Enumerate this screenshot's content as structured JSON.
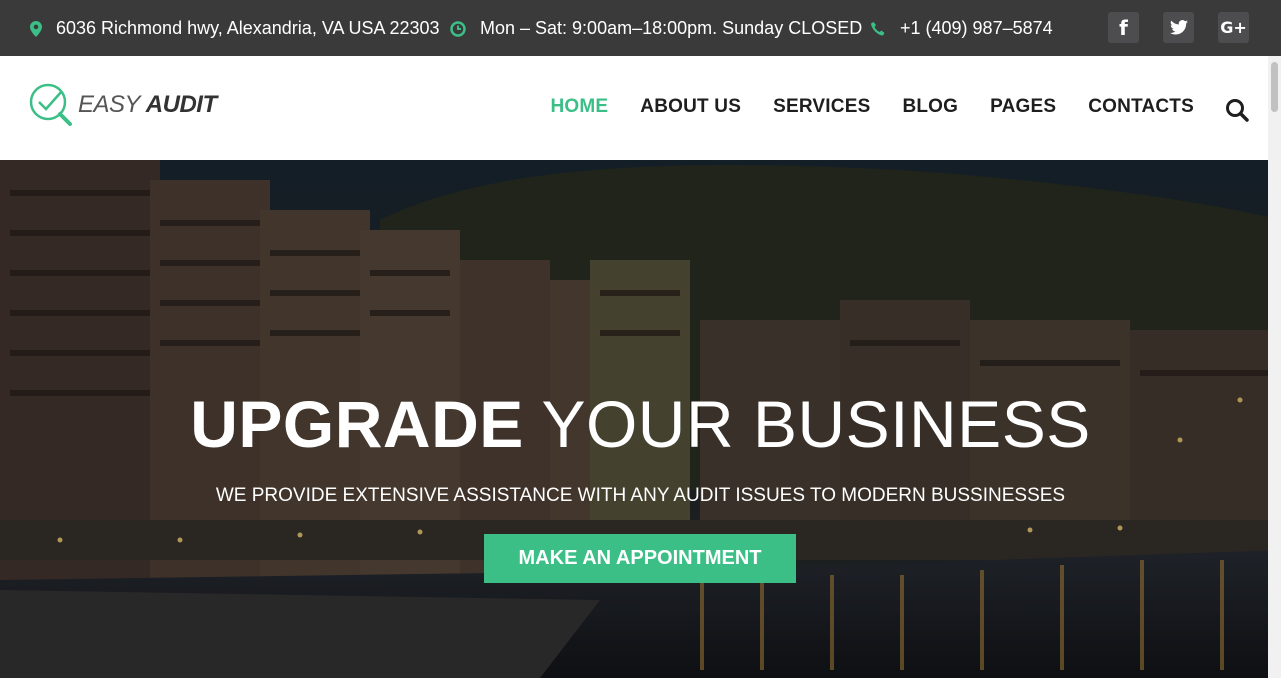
{
  "topbar": {
    "address": "6036 Richmond hwy, Alexandria, VA USA 22303",
    "hours": "Mon – Sat: 9:00am–18:00pm. Sunday CLOSED",
    "phone": "+1 (409) 987–5874",
    "social": {
      "facebook": "f",
      "twitter": "twitter",
      "google": "G+"
    }
  },
  "logo": {
    "part1": "EASY",
    "part2": "AUDIT"
  },
  "nav": {
    "items": [
      "HOME",
      "ABOUT US",
      "SERVICES",
      "BLOG",
      "PAGES",
      "CONTACTS"
    ],
    "active": "HOME"
  },
  "hero": {
    "title_strong": "UPGRADE",
    "title_rest": "YOUR BUSINESS",
    "subtitle": "WE PROVIDE EXTENSIVE ASSISTANCE WITH ANY AUDIT ISSUES TO MODERN BUSSINESSES",
    "button": "MAKE AN APPOINTMENT"
  },
  "colors": {
    "accent": "#3cbf86",
    "topbar": "#3a3a3b"
  }
}
